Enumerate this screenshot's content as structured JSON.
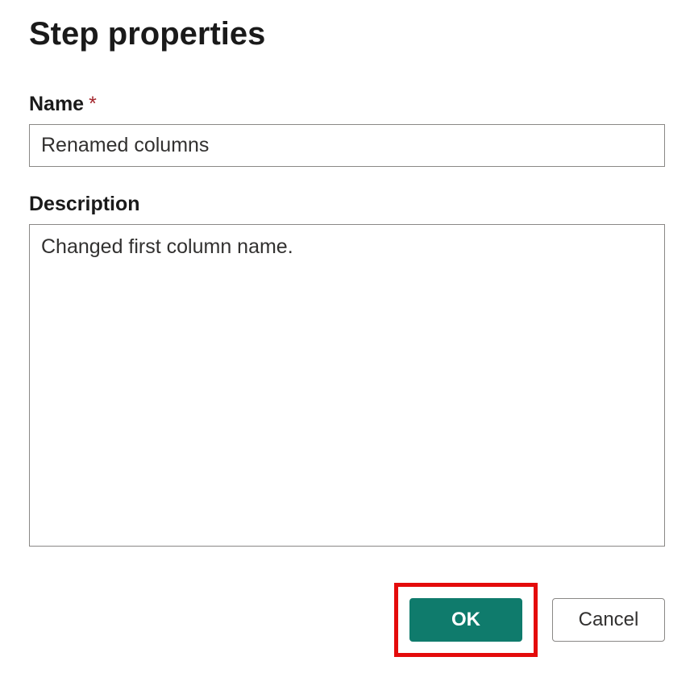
{
  "dialog": {
    "title": "Step properties",
    "fields": {
      "name": {
        "label": "Name",
        "required_marker": "*",
        "value": "Renamed columns"
      },
      "description": {
        "label": "Description",
        "value": "Changed first column name."
      }
    },
    "buttons": {
      "ok": "OK",
      "cancel": "Cancel"
    }
  }
}
